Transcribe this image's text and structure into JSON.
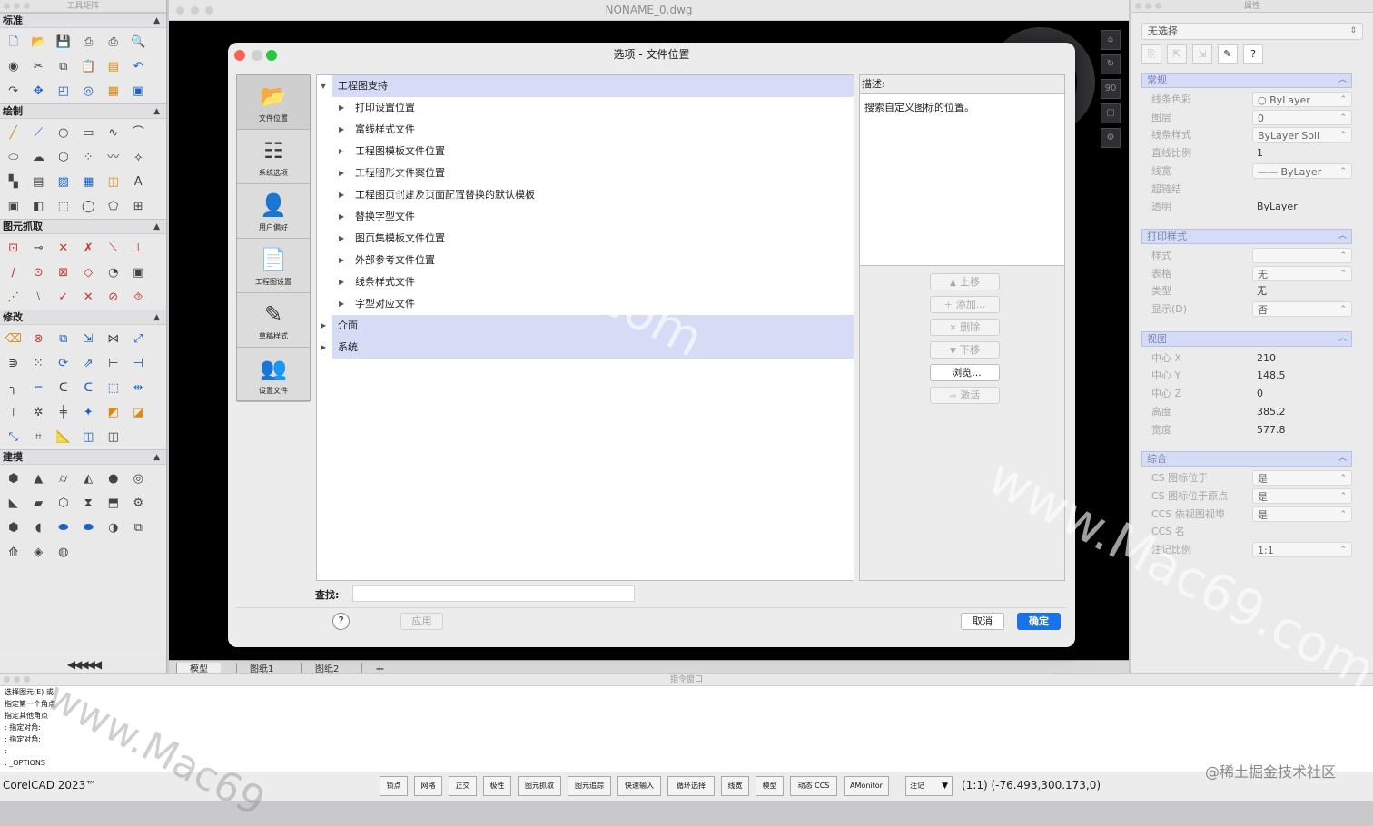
{
  "tool_palette": {
    "title": "工具矩阵",
    "sections": [
      {
        "label": "标准",
        "icons": [
          {
            "name": "new-file-icon",
            "g": "🗋",
            "c": "c-blue"
          },
          {
            "name": "open-folder-icon",
            "g": "📂",
            "c": "c-org"
          },
          {
            "name": "save-icon",
            "g": "💾",
            "c": "c-blue"
          },
          {
            "name": "print-icon",
            "g": "⎙",
            "c": ""
          },
          {
            "name": "plot-icon",
            "g": "⎙",
            "c": ""
          },
          {
            "name": "print-preview-icon",
            "g": "🔍",
            "c": ""
          },
          {
            "name": "render-icon",
            "g": "◉",
            "c": ""
          },
          {
            "name": "cut-icon",
            "g": "✂",
            "c": ""
          },
          {
            "name": "copy-icon",
            "g": "⧉",
            "c": ""
          },
          {
            "name": "paste-icon",
            "g": "📋",
            "c": ""
          },
          {
            "name": "match-properties-icon",
            "g": "▤",
            "c": "c-org"
          },
          {
            "name": "undo-icon",
            "g": "↶",
            "c": "c-blue"
          },
          {
            "name": "redo-icon",
            "g": "↷",
            "c": ""
          },
          {
            "name": "pan-icon",
            "g": "✥",
            "c": "c-blue"
          },
          {
            "name": "zoom-window-icon",
            "g": "◰",
            "c": "c-blue"
          },
          {
            "name": "zoom-realtime-icon",
            "g": "◎",
            "c": "c-blue"
          },
          {
            "name": "properties-icon",
            "g": "▦",
            "c": "c-org"
          },
          {
            "name": "design-center-icon",
            "g": "▣",
            "c": "c-blue"
          }
        ]
      },
      {
        "label": "绘制",
        "icons": [
          {
            "name": "line-icon",
            "g": "╱",
            "c": "c-org"
          },
          {
            "name": "polyline-icon",
            "g": "⟋",
            "c": "c-blue"
          },
          {
            "name": "circle-icon",
            "g": "○",
            "c": ""
          },
          {
            "name": "rectangle-icon",
            "g": "▭",
            "c": ""
          },
          {
            "name": "spline-icon",
            "g": "∿",
            "c": ""
          },
          {
            "name": "arc-icon",
            "g": "⌒",
            "c": ""
          },
          {
            "name": "ellipse-icon",
            "g": "⬭",
            "c": ""
          },
          {
            "name": "cloud-icon",
            "g": "☁",
            "c": ""
          },
          {
            "name": "region-icon",
            "g": "⬡",
            "c": ""
          },
          {
            "name": "point-icon",
            "g": "⁘",
            "c": ""
          },
          {
            "name": "freehand-icon",
            "g": "〰",
            "c": ""
          },
          {
            "name": "node-icon",
            "g": "⟡",
            "c": ""
          },
          {
            "name": "hatch-icon",
            "g": "▚",
            "c": ""
          },
          {
            "name": "gradient-icon",
            "g": "▤",
            "c": ""
          },
          {
            "name": "fill-icon",
            "g": "▨",
            "c": "c-blue"
          },
          {
            "name": "table-icon",
            "g": "▦",
            "c": "c-blue"
          },
          {
            "name": "block-icon",
            "g": "◫",
            "c": "c-org"
          },
          {
            "name": "text-icon",
            "g": "A",
            "c": ""
          },
          {
            "name": "mtext-icon",
            "g": "▣",
            "c": ""
          },
          {
            "name": "attribute-icon",
            "g": "◧",
            "c": ""
          },
          {
            "name": "boundary-icon",
            "g": "⬚",
            "c": ""
          },
          {
            "name": "donut-icon",
            "g": "◯",
            "c": ""
          },
          {
            "name": "wipeout-icon",
            "g": "⬠",
            "c": ""
          },
          {
            "name": "insert-block-icon",
            "g": "⊞",
            "c": ""
          }
        ]
      },
      {
        "label": "图元抓取",
        "icons": [
          {
            "name": "snap-endpoint-icon",
            "g": "⊡",
            "c": "c-red"
          },
          {
            "name": "snap-midpoint-icon",
            "g": "⊸",
            "c": ""
          },
          {
            "name": "snap-intersection-icon",
            "g": "✕",
            "c": "c-red"
          },
          {
            "name": "snap-apparent-icon",
            "g": "✗",
            "c": "c-red"
          },
          {
            "name": "snap-extension-icon",
            "g": "⟍",
            "c": "c-red"
          },
          {
            "name": "snap-perpendicular-icon",
            "g": "⊥",
            "c": "c-red"
          },
          {
            "name": "snap-parallel-icon",
            "g": "∕",
            "c": "c-red"
          },
          {
            "name": "snap-center-icon",
            "g": "⊙",
            "c": "c-red"
          },
          {
            "name": "snap-node-icon",
            "g": "⊠",
            "c": "c-red"
          },
          {
            "name": "snap-quadrant-icon",
            "g": "◇",
            "c": "c-red"
          },
          {
            "name": "snap-tangent-icon",
            "g": "◔",
            "c": ""
          },
          {
            "name": "snap-insertion-icon",
            "g": "▣",
            "c": ""
          },
          {
            "name": "snap-nearest-icon",
            "g": "⋰",
            "c": "c-red"
          },
          {
            "name": "snap-none-icon",
            "g": "⧵",
            "c": ""
          },
          {
            "name": "snap-clear-icon",
            "g": "✓",
            "c": "c-red"
          },
          {
            "name": "snap-from-icon",
            "g": "✕",
            "c": "c-red"
          },
          {
            "name": "snap-settings-icon",
            "g": "⊘",
            "c": "c-red"
          },
          {
            "name": "snap-toggle-icon",
            "g": "⯑",
            "c": "c-red"
          }
        ]
      },
      {
        "label": "修改",
        "icons": [
          {
            "name": "erase-icon",
            "g": "⌫",
            "c": "c-org"
          },
          {
            "name": "delete-icon",
            "g": "⊗",
            "c": "c-red"
          },
          {
            "name": "copy-entity-icon",
            "g": "⧉",
            "c": "c-blue"
          },
          {
            "name": "move-icon",
            "g": "⇲",
            "c": "c-blue"
          },
          {
            "name": "mirror-icon",
            "g": "⋈",
            "c": ""
          },
          {
            "name": "scale-icon",
            "g": "⤢",
            "c": "c-blue"
          },
          {
            "name": "offset-icon",
            "g": "⋑",
            "c": ""
          },
          {
            "name": "array-icon",
            "g": "⁙",
            "c": ""
          },
          {
            "name": "rotate-icon",
            "g": "⟳",
            "c": "c-blue"
          },
          {
            "name": "stretch-icon",
            "g": "⇗",
            "c": "c-blue"
          },
          {
            "name": "trim-icon",
            "g": "⊢",
            "c": ""
          },
          {
            "name": "extend-icon",
            "g": "⊣",
            "c": "c-blue"
          },
          {
            "name": "fillet-icon",
            "g": "╮",
            "c": ""
          },
          {
            "name": "chamfer-icon",
            "g": "⌐",
            "c": "c-blue"
          },
          {
            "name": "break-icon",
            "g": "ᑕ",
            "c": ""
          },
          {
            "name": "join-icon",
            "g": "ᑕ",
            "c": "c-blue"
          },
          {
            "name": "lengthen-icon",
            "g": "⬚",
            "c": "c-blue"
          },
          {
            "name": "explode-icon",
            "g": "⇹",
            "c": "c-blue"
          },
          {
            "name": "edit-polyline-icon",
            "g": "⊤",
            "c": ""
          },
          {
            "name": "edit-spline-icon",
            "g": "✲",
            "c": ""
          },
          {
            "name": "edit-hatch-icon",
            "g": "╪",
            "c": ""
          },
          {
            "name": "edit-text-icon",
            "g": "✦",
            "c": "c-blue"
          },
          {
            "name": "edit-block-icon",
            "g": "◩",
            "c": "c-org"
          },
          {
            "name": "edit-attr-icon",
            "g": "◪",
            "c": "c-org"
          },
          {
            "name": "align-icon",
            "g": "⤡",
            "c": "c-blue"
          },
          {
            "name": "divide-icon",
            "g": "⌗",
            "c": ""
          },
          {
            "name": "measure-icon",
            "g": "📐",
            "c": "c-org"
          },
          {
            "name": "group-icon",
            "g": "◫",
            "c": "c-blue"
          },
          {
            "name": "ungroup-icon",
            "g": "◫",
            "c": ""
          }
        ]
      },
      {
        "label": "建模",
        "icons": [
          {
            "name": "box-icon",
            "g": "⬢",
            "c": ""
          },
          {
            "name": "cone-icon",
            "g": "▲",
            "c": ""
          },
          {
            "name": "cylinder-icon",
            "g": "⌭",
            "c": ""
          },
          {
            "name": "pyramid-icon",
            "g": "◭",
            "c": ""
          },
          {
            "name": "sphere-icon",
            "g": "●",
            "c": ""
          },
          {
            "name": "torus-icon",
            "g": "◎",
            "c": ""
          },
          {
            "name": "wedge-icon",
            "g": "◣",
            "c": ""
          },
          {
            "name": "extrude-icon",
            "g": "▰",
            "c": ""
          },
          {
            "name": "revolve-icon",
            "g": "⬡",
            "c": ""
          },
          {
            "name": "sweep-icon",
            "g": "⧗",
            "c": ""
          },
          {
            "name": "loft-icon",
            "g": "⬒",
            "c": ""
          },
          {
            "name": "press-pull-icon",
            "g": "⚙",
            "c": ""
          },
          {
            "name": "union-icon",
            "g": "⬢",
            "c": ""
          },
          {
            "name": "subtract-icon",
            "g": "◖",
            "c": ""
          },
          {
            "name": "intersect-icon",
            "g": "⬬",
            "c": "c-blue"
          },
          {
            "name": "interfere-icon",
            "g": "⬬",
            "c": "c-blue"
          },
          {
            "name": "slice-icon",
            "g": "◑",
            "c": ""
          },
          {
            "name": "section-icon",
            "g": "⧉",
            "c": ""
          },
          {
            "name": "helix-icon",
            "g": "⟰",
            "c": ""
          },
          {
            "name": "shell-icon",
            "g": "◈",
            "c": ""
          },
          {
            "name": "globe-icon",
            "g": "◍",
            "c": ""
          }
        ]
      }
    ],
    "footer": "◀◀◀◀◀"
  },
  "main_window": {
    "title": "NONAME_0.dwg",
    "nav_buttons": [
      "⌂",
      "↻",
      "90",
      "▢",
      "⚙"
    ],
    "layout_tabs": [
      "模型",
      "图纸1",
      "图纸2",
      "+"
    ]
  },
  "dialog": {
    "title": "选项 - 文件位置",
    "nav": [
      {
        "label": "文件位置",
        "icon": "📂",
        "icon_name": "folder-icon"
      },
      {
        "label": "系统选项",
        "icon": "☷",
        "icon_name": "checklist-icon"
      },
      {
        "label": "用户偏好",
        "icon": "👤",
        "icon_name": "user-icon"
      },
      {
        "label": "工程图设置",
        "icon": "📄",
        "icon_name": "drawing-settings-icon"
      },
      {
        "label": "草稿样式",
        "icon": "✎",
        "icon_name": "draft-style-icon"
      },
      {
        "label": "设置文件",
        "icon": "👥",
        "icon_name": "profile-icon"
      }
    ],
    "tree": [
      {
        "label": "工程图支持",
        "level": 0,
        "expander": "▼",
        "hl": true
      },
      {
        "label": "打印设置位置",
        "level": 1,
        "expander": "▶",
        "hl": false
      },
      {
        "label": "富线样式文件",
        "level": 1,
        "expander": "▶",
        "hl": false
      },
      {
        "label": "工程图模板文件位置",
        "level": 1,
        "expander": "▶",
        "hl": false
      },
      {
        "label": "工程图形文件案位置",
        "level": 1,
        "expander": "▶",
        "hl": false
      },
      {
        "label": "工程图页创建及页面配置替换的默认模板",
        "level": 1,
        "expander": "▶",
        "hl": false
      },
      {
        "label": "替换字型文件",
        "level": 1,
        "expander": "▶",
        "hl": false
      },
      {
        "label": "图页集模板文件位置",
        "level": 1,
        "expander": "▶",
        "hl": false
      },
      {
        "label": "外部参考文件位置",
        "level": 1,
        "expander": "▶",
        "hl": false
      },
      {
        "label": "线条样式文件",
        "level": 1,
        "expander": "▶",
        "hl": false
      },
      {
        "label": "字型对应文件",
        "level": 1,
        "expander": "▶",
        "hl": false
      },
      {
        "label": "介面",
        "level": 0,
        "expander": "▶",
        "hl": true
      },
      {
        "label": "系统",
        "level": 0,
        "expander": "▶",
        "hl": true
      }
    ],
    "description_label": "描述:",
    "description_text": "搜索自定义图标的位置。",
    "side_buttons": [
      {
        "label": "上移",
        "icon": "▲",
        "enabled": false
      },
      {
        "label": "添加...",
        "icon": "＋",
        "enabled": false
      },
      {
        "label": "删除",
        "icon": "✕",
        "enabled": false
      },
      {
        "label": "下移",
        "icon": "▼",
        "enabled": false
      },
      {
        "label": "浏览...",
        "icon": "",
        "enabled": true
      },
      {
        "label": "激活",
        "icon": "⇨",
        "enabled": false
      }
    ],
    "find_label": "查找:",
    "find_value": "",
    "help": "?",
    "apply": "应用",
    "cancel": "取消",
    "ok": "确定"
  },
  "properties": {
    "title": "属性",
    "selection": "无选择",
    "tool_buttons": [
      "⎘",
      "⇱",
      "⇲",
      "✎",
      "?"
    ],
    "groups": [
      {
        "label": "常规",
        "rows": [
          {
            "k": "线条色彩",
            "v": "○ ByLayer",
            "dd": true
          },
          {
            "k": "图层",
            "v": "0",
            "dd": true
          },
          {
            "k": "线条样式",
            "v": "ByLayer    Soli",
            "dd": true
          },
          {
            "k": "直线比例",
            "v": "1",
            "dd": false
          },
          {
            "k": "线宽",
            "v": "—— ByLayer",
            "dd": true
          },
          {
            "k": "超链结",
            "v": "",
            "dd": false
          },
          {
            "k": "透明",
            "v": "ByLayer",
            "dd": false
          }
        ]
      },
      {
        "label": "打印样式",
        "rows": [
          {
            "k": "样式",
            "v": "",
            "dd": true
          },
          {
            "k": "表格",
            "v": "无",
            "dd": true
          },
          {
            "k": "类型",
            "v": "无",
            "dd": false
          },
          {
            "k": "显示(D)",
            "v": "否",
            "dd": true
          }
        ]
      },
      {
        "label": "视图",
        "rows": [
          {
            "k": "中心 X",
            "v": "210",
            "dd": false
          },
          {
            "k": "中心 Y",
            "v": "148.5",
            "dd": false
          },
          {
            "k": "中心 Z",
            "v": "0",
            "dd": false
          },
          {
            "k": "高度",
            "v": "385.2",
            "dd": false
          },
          {
            "k": "宽度",
            "v": "577.8",
            "dd": false
          }
        ]
      },
      {
        "label": "综合",
        "rows": [
          {
            "k": "CS 图标位于",
            "v": "是",
            "dd": true
          },
          {
            "k": "CS 图标位于原点",
            "v": "是",
            "dd": true
          },
          {
            "k": "CCS 依视图视埠",
            "v": "是",
            "dd": true
          },
          {
            "k": "CCS 名",
            "v": "",
            "dd": false
          },
          {
            "k": "注记比例",
            "v": "1:1",
            "dd": true
          }
        ]
      }
    ]
  },
  "command_window": {
    "title": "指令窗口",
    "lines": [
      "选择图元(E) 或",
      "指定第一个角点",
      "指定其他角点",
      ": 指定对角:",
      ": 指定对角:",
      ":",
      ": _OPTIONS"
    ]
  },
  "status_bar": {
    "app_name": "CorelCAD 2023™",
    "buttons": [
      "锁点",
      "网格",
      "正交",
      "极性",
      "图元抓取",
      "图元追踪",
      "快速输入",
      "循环选择",
      "线宽",
      "模型",
      "动态 CCS",
      "AMonitor"
    ],
    "annotation": "注记",
    "coords": "(1:1)  (-76.493,300.173,0)"
  },
  "watermarks": [
    "www.Mac69.com",
    "www.Mac69.com",
    "www.Mac69"
  ],
  "corner_mark": "@稀土掘金技术社区"
}
